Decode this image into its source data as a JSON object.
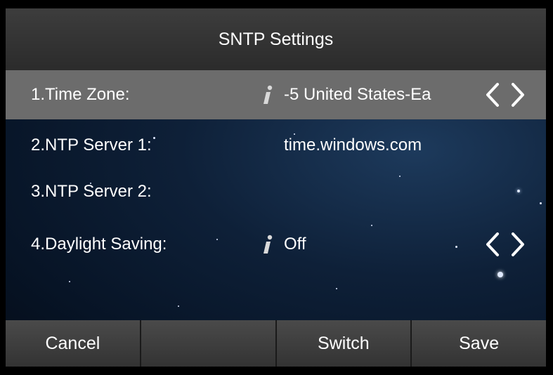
{
  "title": "SNTP Settings",
  "rows": [
    {
      "label": "1.Time Zone:",
      "value": "-5 United States-Ea",
      "has_info": true,
      "has_arrows": true,
      "selected": true
    },
    {
      "label": "2.NTP Server 1:",
      "value": "time.windows.com",
      "has_info": false,
      "has_arrows": false,
      "selected": false
    },
    {
      "label": "3.NTP Server 2:",
      "value": "",
      "has_info": false,
      "has_arrows": false,
      "selected": false
    },
    {
      "label": "4.Daylight Saving:",
      "value": "Off",
      "has_info": true,
      "has_arrows": true,
      "selected": false
    }
  ],
  "softkeys": [
    "Cancel",
    "",
    "Switch",
    "Save"
  ],
  "icons": {
    "info": "info-icon",
    "left": "chevron-left-icon",
    "right": "chevron-right-icon"
  },
  "colors": {
    "titlebar": "#333333",
    "selected_row": "#6c6c6c",
    "softkey": "#3f3f3f",
    "info_icon": "#d9d9d9"
  }
}
